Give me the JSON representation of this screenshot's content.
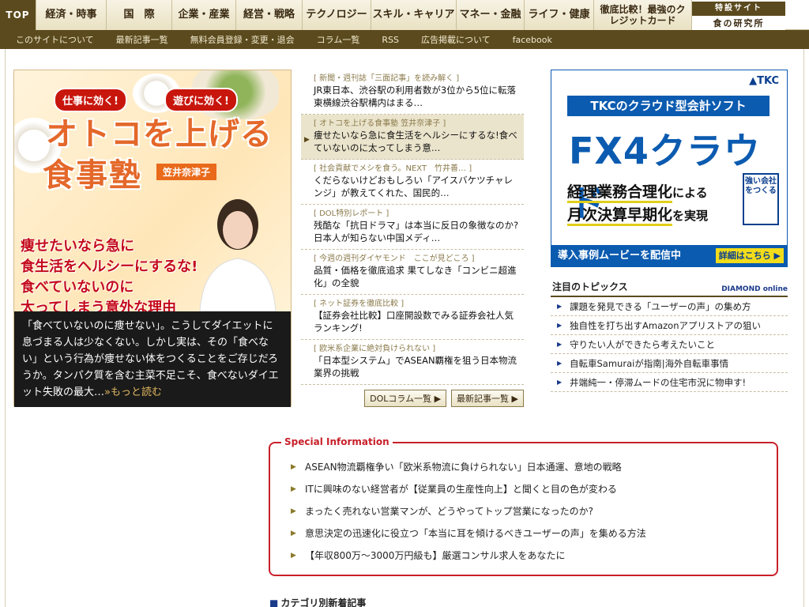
{
  "topnav": {
    "tabs": [
      {
        "label": "TOP"
      },
      {
        "label": "経済・時事"
      },
      {
        "label": "国　際"
      },
      {
        "label": "企業・産業"
      },
      {
        "label": "経営・戦略"
      },
      {
        "label": "テクノロジー"
      },
      {
        "label": "スキル・キャリア"
      },
      {
        "label": "マネー・金融"
      },
      {
        "label": "ライフ・健康"
      },
      {
        "label": "徹底比較！最強のクレジットカード"
      }
    ],
    "tokusetsu": {
      "top": "特設サイト",
      "bottom": "食の研究所"
    }
  },
  "subnav": [
    "このサイトについて",
    "最新記事一覧",
    "無料会員登録・変更・退会",
    "コラム一覧",
    "RSS",
    "広告掲載について",
    "facebook"
  ],
  "hero": {
    "bubble_left": "仕事に効く!",
    "bubble_right": "遊びに効く!",
    "title_line1": "オトコを上げる",
    "title_line2": "食事塾",
    "author": "笠井奈津子",
    "catch_line1": "痩せたいなら急に",
    "catch_line2": "食生活をヘルシーにするな!",
    "catch_line3": "食べていないのに",
    "catch_line4": "太ってしまう意外な理由",
    "desc": "「食べていないのに痩せない」。こうしてダイエットに息づまる人は少なくない。しかし実は、その「食べない」という行為が痩せない体をつくることをご存じだろうか。タンパク質を含む主菜不足こそ、食べないダイエット失敗の最大…",
    "more": "»もっと読む"
  },
  "news": {
    "items": [
      {
        "cat": "[ 新聞・週刊誌「三面記事」を読み解く ]",
        "head": "JR東日本、渋谷駅の利用者数が3位から5位に転落 東横線渋谷駅構内はまる…"
      },
      {
        "cat": "[ オトコを上げる食事塾 笠井奈津子 ]",
        "head": "痩せたいなら急に食生活をヘルシーにするな!食べていないのに太ってしまう意…"
      },
      {
        "cat": "[ 社会貢献でメシを食う。NEXT　竹井善… ]",
        "head": "くだらないけどおもしろい「アイスバケツチャレンジ」が教えてくれた、国民的…"
      },
      {
        "cat": "[ DOL特別レポート ]",
        "head": "残酷な「抗日ドラマ」は本当に反日の象徴なのか?日本人が知らない中国メディ…"
      },
      {
        "cat": "[ 今週の週刊ダイヤモンド　ここが見どころ ]",
        "head": "品質・価格を徹底追求 果てしなき「コンビニ超進化」の全貌"
      },
      {
        "cat": "[ ネット証券を徹底比較 ]",
        "head": "【証券会社比較】口座開設数でみる証券会社人気ランキング!"
      },
      {
        "cat": "[ 欧米系企業に絶対負けられない ]",
        "head": "「日本型システム」でASEAN覇権を狙う日本物流業界の挑戦"
      }
    ],
    "btn_column": "DOLコラム一覧 ▶",
    "btn_latest": "最新記事一覧 ▶"
  },
  "ad": {
    "logo": "TKC",
    "bar": "TKCのクラウド型会計ソフト",
    "product": "FX4クラウド",
    "line1_em": "経理業務合理化",
    "line1_rest": "による",
    "line2_em": "月次決算早期化",
    "line2_rest": "を実現",
    "seal": "強い会社をつくる",
    "foot": "導入事例ムービーを配信中",
    "detail": "詳細はこちら ▶"
  },
  "topics": {
    "title": "注目のトピックス",
    "brand": "DIAMOND online",
    "items": [
      "課題を発見できる「ユーザーの声」の集め方",
      "独自性を打ち出すAmazonアプリストアの狙い",
      "守りたい人ができたら考えたいこと",
      "自転車Samuraiが指南|海外自転車事情",
      "井端純一・停滞ムードの住宅市況に物申す!"
    ]
  },
  "special": {
    "label": "Special Information",
    "items": [
      "ASEAN物流覇権争い「欧米系物流に負けられない」日本通運、意地の戦略",
      "ITに興味のない経営者が【従業員の生産性向上】と聞くと目の色が変わる",
      "まったく売れない営業マンが、どうやってトップ営業になったのか?",
      "意思決定の迅速化に役立つ「本当に耳を傾けるべきユーザーの声」を集める方法",
      "【年収800万～3000万円級も】厳選コンサル求人をあなたに"
    ]
  },
  "category_new": "カテゴリ別新着記事"
}
